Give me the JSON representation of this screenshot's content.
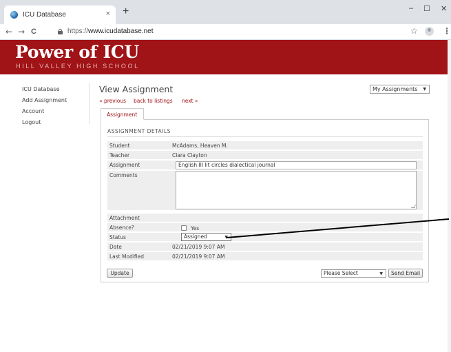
{
  "browser": {
    "tab_title": "ICU Database",
    "tab_close": "×",
    "new_tab": "+",
    "url_scheme": "https://",
    "url_host": "www.icudatabase.net",
    "window_controls": {
      "minimize": "–",
      "maximize": "☐",
      "close": "✕"
    },
    "nav": {
      "back": "←",
      "forward": "→",
      "reload": "C"
    },
    "star": "☆",
    "menu": "⋮"
  },
  "site": {
    "title": "Power of ICU",
    "subtitle": "HILL VALLEY HIGH SCHOOL",
    "brand_color": "#a01316"
  },
  "sidebar": {
    "items": [
      {
        "label": "ICU Database"
      },
      {
        "label": "Add Assignment"
      },
      {
        "label": "Account"
      },
      {
        "label": "Logout"
      }
    ]
  },
  "main": {
    "page_title": "View Assignment",
    "my_assignments": "My Assignments",
    "nav_links": {
      "previous": "« previous",
      "back": "back to listings",
      "next": "next »"
    },
    "tab_label": "Assignment",
    "section_heading": "ASSIGNMENT DETAILS",
    "fields": {
      "student": {
        "label": "Student",
        "value": "McAdams, Heaven M."
      },
      "teacher": {
        "label": "Teacher",
        "value": "Clara Clayton"
      },
      "assignment": {
        "label": "Assignment",
        "value": "English III lit circles dialectical journal"
      },
      "comments": {
        "label": "Comments",
        "value": ""
      },
      "attachment": {
        "label": "Attachment"
      },
      "absence": {
        "label": "Absence?",
        "checkbox_label": "Yes",
        "checked": false
      },
      "status": {
        "label": "Status",
        "value": "Assigned"
      },
      "date": {
        "label": "Date",
        "value": "02/21/2019 9:07 AM"
      },
      "last_modified": {
        "label": "Last Modified",
        "value": "02/21/2019 9:07 AM"
      }
    },
    "update_button": "Update",
    "email_select": "Please Select",
    "send_email_button": "Send Email",
    "dropdown_caret": "▼"
  }
}
